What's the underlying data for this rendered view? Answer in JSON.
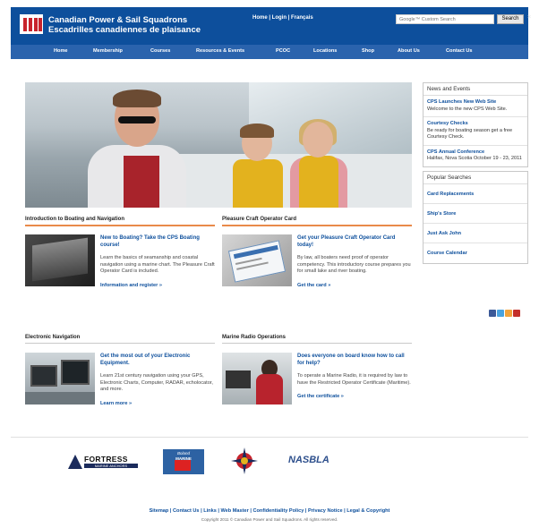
{
  "header": {
    "brand_line1": "Canadian Power & Sail Squadrons",
    "brand_line2": "Escadrilles canadiennes de plaisance",
    "top_links": "Home | Login | Français",
    "search_placeholder": "Google™ Custom Search",
    "search_button": "Search",
    "close_glyph": "×"
  },
  "nav": {
    "items": [
      "Home",
      "Membership",
      "Courses",
      "Resources & Events",
      "PCOC",
      "Locations",
      "Shop",
      "About Us",
      "Contact Us"
    ]
  },
  "sidebar": {
    "news_heading": "News and Events",
    "news": [
      {
        "title": "CPS Launches New Web Site",
        "body": "Welcome to the new CPS Web Site."
      },
      {
        "title": "Courtesy Checks",
        "body": "Be ready for boating season get a free Courtesy Check."
      },
      {
        "title": "CPS Annual Conference",
        "body": "Halifax, Nova Scotia October 19 - 23, 2011"
      }
    ],
    "popular_heading": "Popular Searches",
    "popular": [
      "Card Replacements",
      "Ship's Store",
      "Just Ask John",
      "Course Calendar"
    ]
  },
  "sections": [
    {
      "title": "Introduction to Boating and Navigation",
      "lead": "New to Boating? Take the CPS Boating course!",
      "body": "Learn the basics of seamanship and coastal navigation using a marine chart. The Pleasure Craft Operator Card is included.",
      "link": "Information and register »"
    },
    {
      "title": "Pleasure Craft Operator Card",
      "lead": "Get your Pleasure Craft Operator Card today!",
      "body": "By law, all boaters need proof of operator competency. This introductory course prepares you for small lake and river boating.",
      "link": "Get the card »"
    },
    {
      "title": "Electronic Navigation",
      "lead": "Get the most out of your Electronic Equipment.",
      "body": "Learn 21st century navigation using your GPS, Electronic Charts, Computer, RADAR, echolocator, and more.",
      "link": "Learn more »"
    },
    {
      "title": "Marine Radio Operations",
      "lead": "Does everyone on board know how to call for help?",
      "body": "To operate a Marine Radio, it is required by law to have the Restricted Operator Certificate (Maritime).",
      "link": "Get the certificate »"
    }
  ],
  "partners": {
    "fortress": "FORTRESS",
    "fortress_sub": "MARINE ANCHORS",
    "boland_line1": "Boland",
    "boland_line2": "MARINE",
    "nasbla": "NASBLA"
  },
  "footer": {
    "links": "Sitemap | Contact Us | Links | Web Master | Confidentiality Policy | Privacy Notice | Legal & Copyright",
    "copyright": "Copyright 2011 © Canadian Power and Sail Squadrons. All rights reserved."
  },
  "colors": {
    "header_blue": "#0d4f9c",
    "nav_blue": "#2a63ad",
    "accent_orange": "#e98a4a",
    "link_blue": "#0d4f9c"
  }
}
